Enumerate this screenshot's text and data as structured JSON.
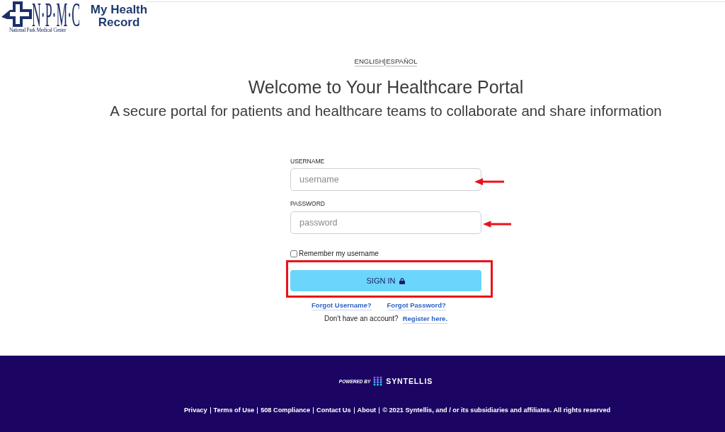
{
  "header": {
    "logo": {
      "letters": "N·P·M·C",
      "subtitle": "National Park Medical Center"
    },
    "app_title": "My Health Record"
  },
  "language_links": [
    {
      "label": "ENGLISH"
    },
    {
      "label": "ESPAÑOL"
    }
  ],
  "title": "Welcome to Your Healthcare Portal",
  "subtitle": "A secure portal for patients and healthcare teams to collaborate and share information",
  "login_form": {
    "fields": [
      {
        "label": "USERNAME",
        "placeholder": "username"
      },
      {
        "label": "PASSWORD",
        "placeholder": "password"
      }
    ],
    "remember": {
      "label": "Remember my username",
      "checked": false
    },
    "sign_in_button": "SIGN IN",
    "links": [
      "Forgot Username?",
      "Forgot Password?"
    ],
    "register": {
      "prompt": "Don't have an account?",
      "link": "Register here."
    }
  },
  "footer": {
    "powered_by": "POWERED BY",
    "brand": "SYNTELLIS",
    "links": [
      "Privacy",
      "Terms of Use",
      "508 Compliance",
      "Contact Us",
      "About"
    ],
    "copyright": "© 2021 Syntellis, and / or its subsidiaries and affiliates. All rights reserved"
  }
}
